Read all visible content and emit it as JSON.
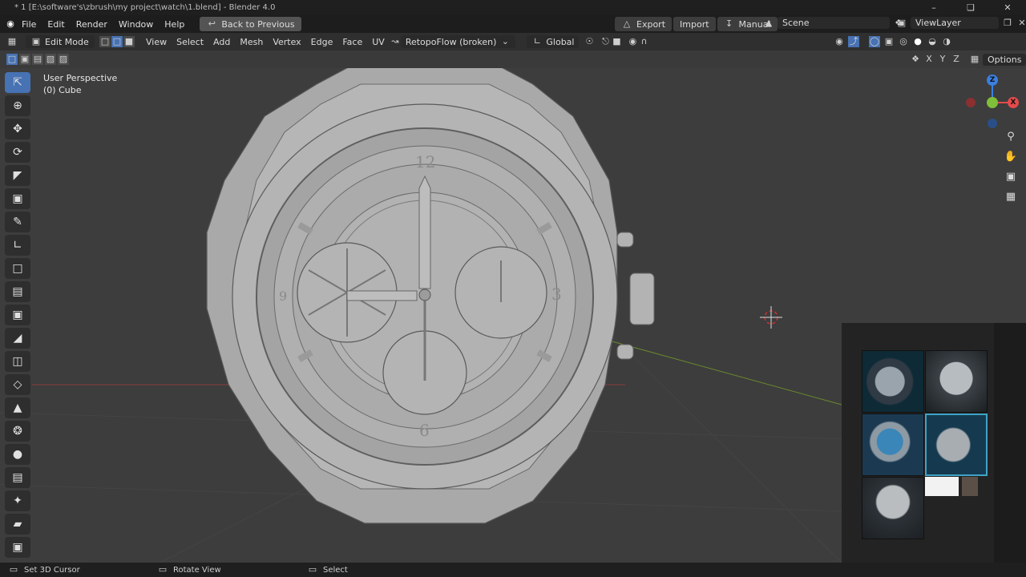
{
  "window": {
    "title": "* 1 [E:\\software's\\zbrush\\my project\\watch\\1.blend] - Blender 4.0"
  },
  "menu": {
    "items": [
      "File",
      "Edit",
      "Render",
      "Window",
      "Help"
    ],
    "back_label": "Back to Previous",
    "export_label": "Export",
    "import_label": "Import",
    "manual_label": "Manual",
    "scene_label": "Scene",
    "viewlayer_label": "ViewLayer"
  },
  "header": {
    "mode": "Edit Mode",
    "menus": [
      "View",
      "Select",
      "Add",
      "Mesh",
      "Vertex",
      "Edge",
      "Face",
      "UV"
    ],
    "addon": "RetopoFlow (broken)",
    "orientation": "Global",
    "options_label": "Options",
    "axes": [
      "X",
      "Y",
      "Z"
    ]
  },
  "viewport": {
    "perspective": "User Perspective",
    "object": "(0) Cube",
    "dial_numbers": {
      "top": "12",
      "right": "3",
      "bottom": "6",
      "left": "9"
    }
  },
  "gizmo": {
    "z": "Z",
    "x": "X"
  },
  "status": {
    "left": "Set 3D Cursor",
    "middle": "Rotate View",
    "right": "Select"
  },
  "colors": {
    "accent": "#4772b3",
    "x_axis": "#e44a4a",
    "y_axis": "#7fbf3a",
    "z_axis": "#3a7fe0"
  }
}
